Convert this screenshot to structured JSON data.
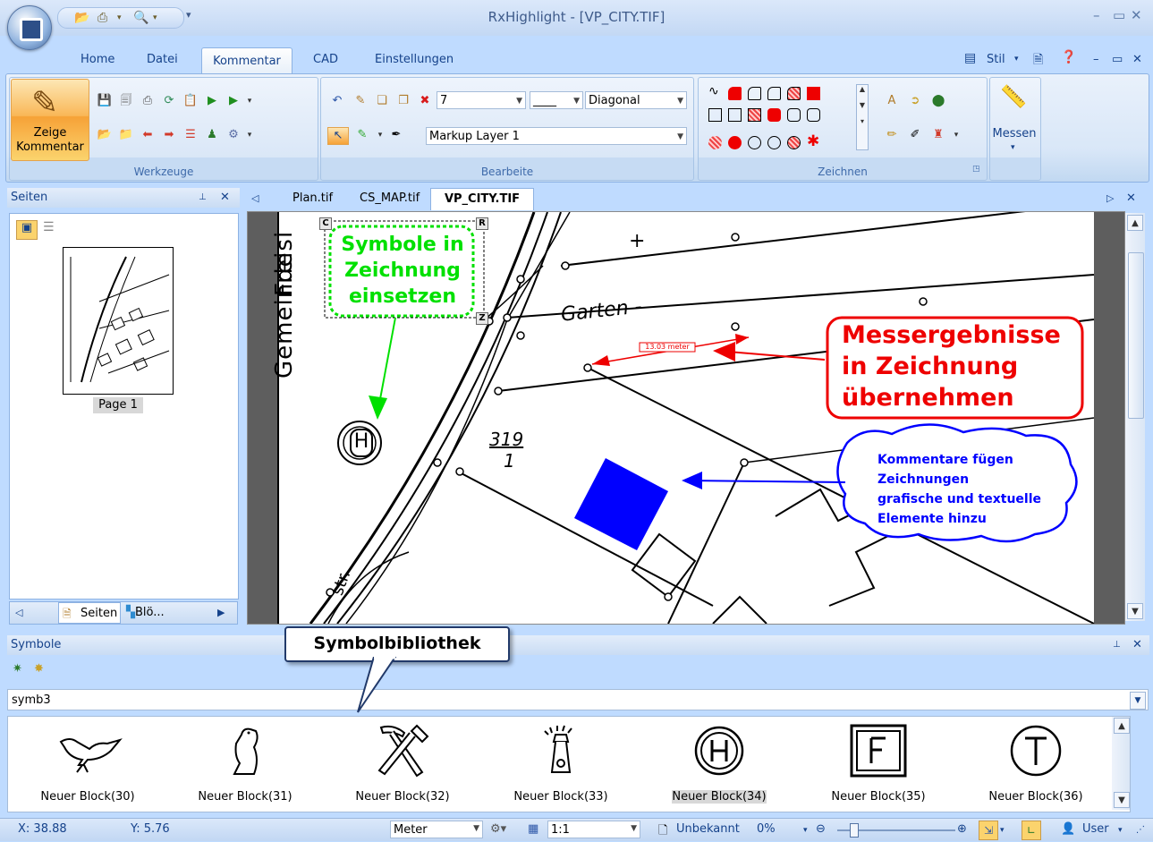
{
  "window": {
    "title": "RxHighlight - [VP_CITY.TIF]"
  },
  "ribbon": {
    "tabs": [
      "Home",
      "Datei",
      "Kommentar",
      "CAD",
      "Einstellungen"
    ],
    "active_tab": "Kommentar",
    "right": {
      "style_label": "Stil"
    },
    "zeige_button": {
      "line1": "Zeige",
      "line2": "Kommentar"
    },
    "groups": {
      "werkzeuge": "Werkzeuge",
      "bearbeite": "Bearbeite",
      "zeichnen": "Zeichnen",
      "messen": "Messen"
    },
    "line_width_value": "7",
    "line_style_value": "____",
    "hatch_value": "Diagonal",
    "layer_value": "Markup Layer 1"
  },
  "pages_panel": {
    "title": "Seiten",
    "page_label": "Page 1",
    "bottom_tabs": [
      "Seiten",
      "Blö..."
    ]
  },
  "doc_tabs": [
    "Plan.tif",
    "CS_MAP.tif",
    "VP_CITY.TIF"
  ],
  "active_doc": "VP_CITY.TIF",
  "drawing": {
    "green_note": [
      "Symbole in",
      "Zeichnung",
      "einsetzen"
    ],
    "handle_c": "C",
    "handle_r": "R",
    "handle_z": "Z",
    "red_note": [
      "Messergebnisse",
      "in Zeichnung",
      "übernehmen"
    ],
    "blue_note": [
      "Kommentare fügen",
      "Zeichnungen",
      "grafische und textuelle",
      "Elemente hinzu"
    ],
    "measure_label": "13.03 meter",
    "map_text_gemeinde": "Gemeinde",
    "map_text_freisi": "Freisi",
    "map_text_garten": "Garten -",
    "parcel_num": "319",
    "parcel_den": "1",
    "map_text_str": "str.",
    "plus": "+"
  },
  "symbols_panel": {
    "title": "Symbole",
    "library_value": "symb3",
    "callout": "Symbolbibliothek",
    "items": [
      {
        "name": "Neuer Block(30)",
        "icon": "bird-icon"
      },
      {
        "name": "Neuer Block(31)",
        "icon": "penguin-icon"
      },
      {
        "name": "Neuer Block(32)",
        "icon": "hammer-pick-icon"
      },
      {
        "name": "Neuer Block(33)",
        "icon": "lighthouse-icon"
      },
      {
        "name": "Neuer Block(34)",
        "icon": "h-circle-icon"
      },
      {
        "name": "Neuer Block(35)",
        "icon": "f-square-icon"
      },
      {
        "name": "Neuer Block(36)",
        "icon": "t-circle-icon"
      }
    ],
    "selected_index": 4
  },
  "statusbar": {
    "x": "X: 38.88",
    "y": "Y: 5.76",
    "unit": "Meter",
    "scale": "1:1",
    "status": "Unbekannt",
    "zoom": "0%",
    "user": "User"
  },
  "colors": {
    "green": "#00e000",
    "red": "#ff0000",
    "blue": "#0000ff",
    "accent": "#15428b"
  }
}
